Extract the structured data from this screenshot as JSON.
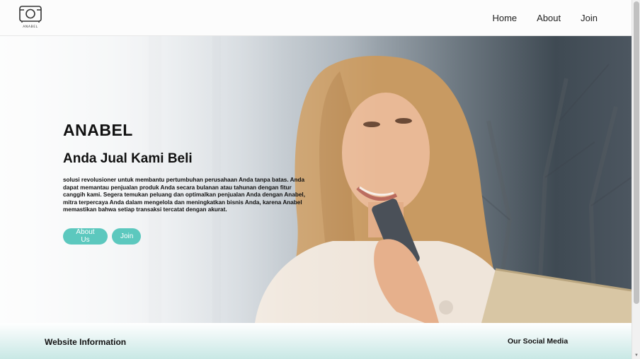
{
  "navbar": {
    "logo_text": "ANABEL",
    "links": [
      {
        "label": "Home"
      },
      {
        "label": "About"
      },
      {
        "label": "Join"
      }
    ]
  },
  "hero": {
    "brand": "ANABEL",
    "title": "Anda Jual Kami Beli",
    "description": "solusi revolusioner untuk membantu pertumbuhan perusahaan Anda tanpa batas. Anda dapat memantau penjualan produk Anda secara bulanan atau tahunan dengan fitur canggih kami. Segera temukan peluang dan optimalkan penjualan Anda dengan Anabel, mitra terpercaya Anda dalam mengelola dan meningkatkan bisnis Anda, karena Anabel memastikan bahwa setiap transaksi tercatat dengan akurat.",
    "buttons": {
      "about_label": "About Us",
      "join_label": "Join"
    },
    "image": "woman-with-phone-and-laptop"
  },
  "footer": {
    "info_heading": "Website Information",
    "social_heading": "Our Social Media"
  },
  "colors": {
    "accent": "#5cc8be",
    "footer_tint": "#c8e8e5",
    "text": "#111111"
  }
}
